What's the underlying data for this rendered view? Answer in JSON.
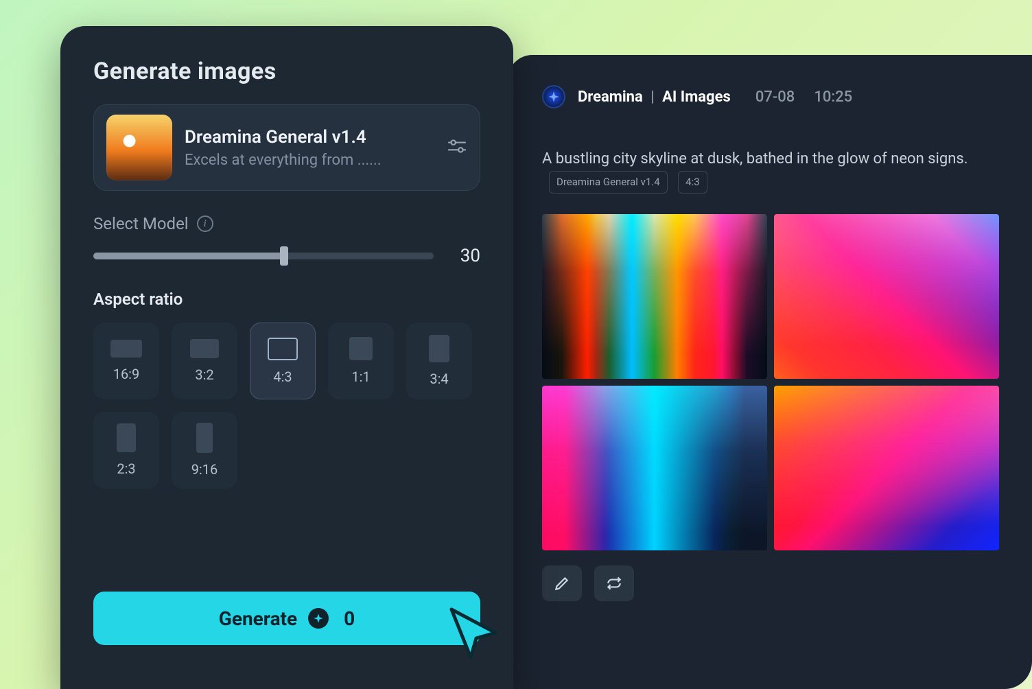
{
  "generator": {
    "title": "Generate images",
    "model": {
      "name": "Dreamina General v1.4",
      "description": "Excels at everything from ......"
    },
    "slider": {
      "label": "Select Model",
      "value": "30"
    },
    "aspect_ratio": {
      "title": "Aspect ratio",
      "options": [
        {
          "label": "16:9",
          "shape": "s-16x9",
          "selected": false
        },
        {
          "label": "3:2",
          "shape": "s-3x2",
          "selected": false
        },
        {
          "label": "4:3",
          "shape": "s-4x3",
          "selected": true
        },
        {
          "label": "1:1",
          "shape": "s-1x1",
          "selected": false
        },
        {
          "label": "3:4",
          "shape": "s-3x4",
          "selected": false
        },
        {
          "label": "2:3",
          "shape": "s-2x3",
          "selected": false
        },
        {
          "label": "9:16",
          "shape": "s-9x16",
          "selected": false
        }
      ]
    },
    "button": {
      "label": "Generate",
      "cost": "0"
    }
  },
  "results": {
    "product": "Dreamina",
    "section": "AI Images",
    "date": "07-08",
    "time": "10:25",
    "prompt": "A bustling city skyline at dusk, bathed in the glow of neon signs.",
    "chips": {
      "model": "Dreamina General v1.4",
      "ratio": "4:3"
    }
  },
  "colors": {
    "accent": "#25d7e6",
    "panel": "#1e2833"
  }
}
